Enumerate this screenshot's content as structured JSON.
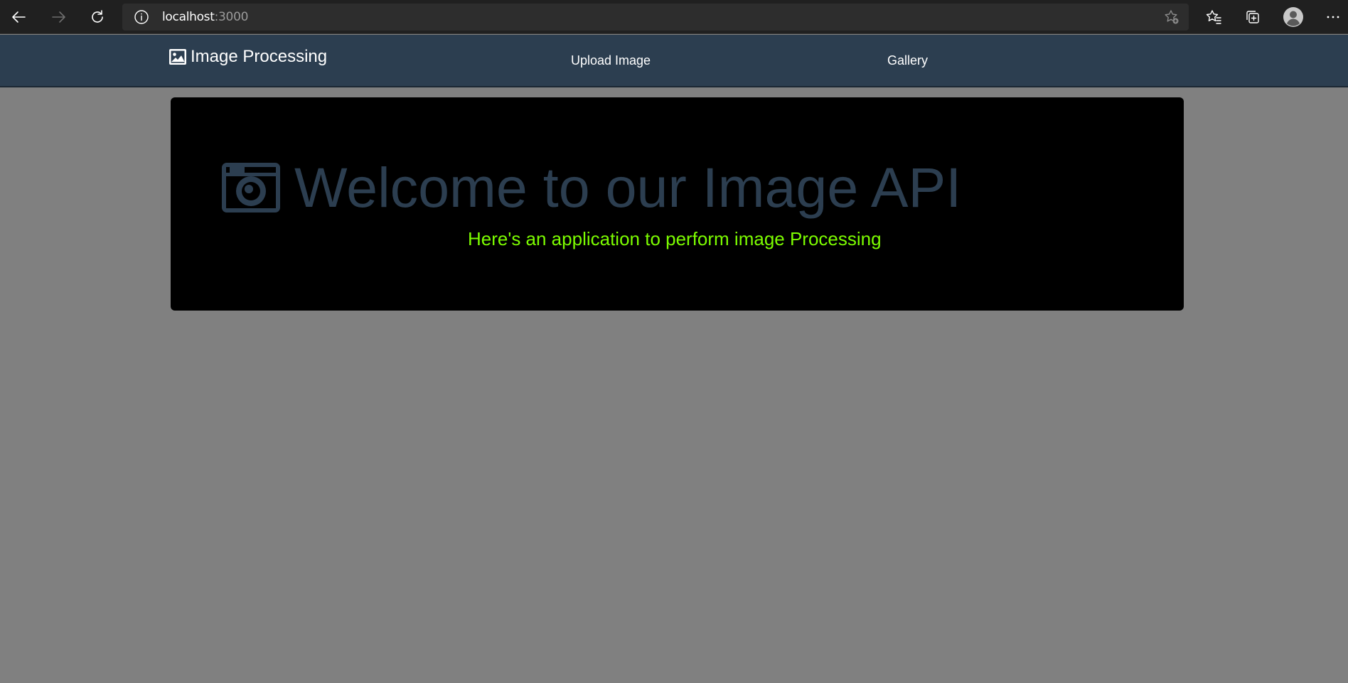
{
  "browser": {
    "url_host": "localhost",
    "url_port": ":3000"
  },
  "navbar": {
    "brand_label": "Image Processing",
    "links": [
      {
        "label": "Upload Image"
      },
      {
        "label": "Gallery"
      }
    ]
  },
  "hero": {
    "title": "Welcome to our Image API",
    "subtitle": "Here's an application to perform image Processing"
  },
  "colors": {
    "page_background": "#808080",
    "navbar_background": "#2c3e50",
    "hero_background": "#000000",
    "hero_title": "#2c3e50",
    "hero_subtitle": "#7cfc00"
  },
  "icons": {
    "brand": "image-icon",
    "hero": "camera-icon"
  }
}
